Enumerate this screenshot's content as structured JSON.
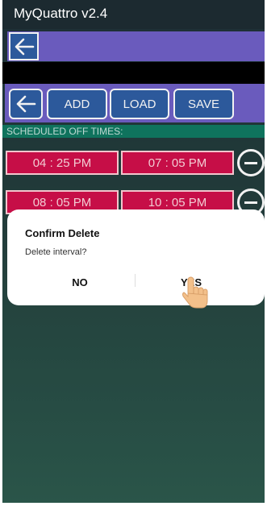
{
  "app": {
    "title": "MyQuattro v2.4"
  },
  "toolbar": {
    "add_label": "ADD",
    "load_label": "LOAD",
    "save_label": "SAVE"
  },
  "section": {
    "label": "SCHEDULED OFF TIMES:"
  },
  "intervals": [
    {
      "start": "04 : 25 PM",
      "end": "07 : 05 PM"
    },
    {
      "start": "08 : 05 PM",
      "end": "10 : 05 PM"
    }
  ],
  "dialog": {
    "title": "Confirm Delete",
    "message": "Delete interval?",
    "no_label": "NO",
    "yes_label": "YES"
  },
  "colors": {
    "accent_bar": "#7060c8",
    "button_fill": "#2f5ea4",
    "time_cell": "#d10f4b",
    "section_bar": "#107a63"
  },
  "icons": [
    "back-arrow-icon",
    "remove-circle-icon",
    "hand-pointer-icon"
  ]
}
